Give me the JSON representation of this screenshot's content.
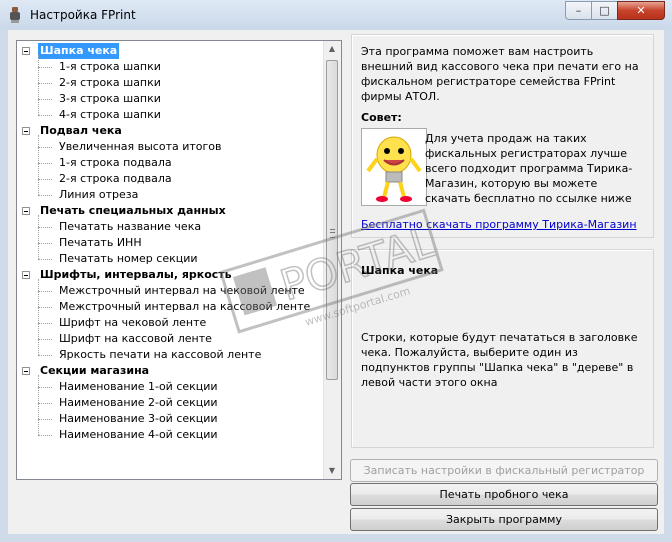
{
  "window": {
    "title": "Настройка FPrint",
    "controls": {
      "minimize": "–",
      "maximize": "□",
      "close": "✕"
    }
  },
  "tree": {
    "groups": [
      {
        "label": "Шапка чека",
        "selected": true,
        "items": [
          "1-я строка шапки",
          "2-я строка шапки",
          "3-я строка шапки",
          "4-я строка шапки"
        ]
      },
      {
        "label": "Подвал чека",
        "items": [
          "Увеличенная высота итогов",
          "1-я строка подвала",
          "2-я строка подвала",
          "Линия отреза"
        ]
      },
      {
        "label": "Печать специальных данных",
        "items": [
          "Печатать название чека",
          "Печатать ИНН",
          "Печатать номер секции"
        ]
      },
      {
        "label": "Шрифты, интервалы, яркость",
        "items": [
          "Межстрочный интервал на чековой ленте",
          "Межстрочный интервал на кассовой ленте",
          "Шрифт на чековой ленте",
          "Шрифт на кассовой ленте",
          "Яркость печати на кассовой ленте"
        ]
      },
      {
        "label": "Секции магазина",
        "items": [
          "Наименование 1-ой секции",
          "Наименование 2-ой секции",
          "Наименование 3-ой секции",
          "Наименование 4-ой секции"
        ]
      }
    ]
  },
  "info": {
    "text": "Эта программа поможет вам настроить внешний вид кассового чека при печати его на фискальном регистраторе семейства FPrint фирмы АТОЛ.",
    "tip_title": "Совет:",
    "tip_text": "Для учета продаж на таких фискальных регистраторах лучше всего подходит программа Тирика-Магазин, которую вы можете скачать бесплатно по ссылке ниже",
    "link": "Бесплатно скачать программу Тирика-Магазин"
  },
  "section": {
    "title": "Шапка чека",
    "description": "Строки, которые будут печататься в заголовке чека. Пожалуйста, выберите один из подпунктов группы \"Шапка чека\" в \"дереве\" в левой части этого окна"
  },
  "buttons": {
    "write": "Записать настройки в фискальный регистратор",
    "test": "Печать пробного чека",
    "close": "Закрыть программу"
  },
  "watermark": {
    "text": "PORTAL",
    "subtext": "www.softportal.com"
  },
  "colors": {
    "selection": "#3399ff",
    "link": "#0000cc",
    "close_button": "#c7432b"
  }
}
